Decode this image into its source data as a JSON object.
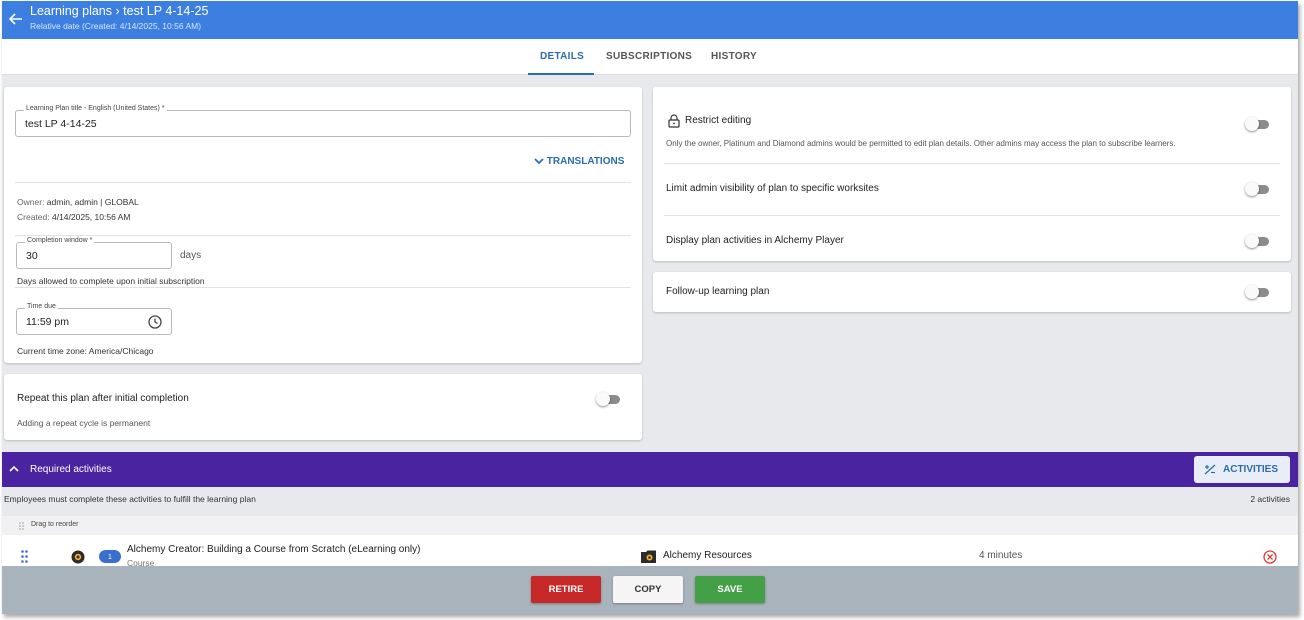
{
  "header": {
    "breadcrumb_root": "Learning plans",
    "breadcrumb_sep": "›",
    "plan_name": "test LP 4-14-25",
    "subtitle": "Relative date (Created: 4/14/2025, 10:56 AM)"
  },
  "tabs": [
    {
      "label": "DETAILS",
      "active": true
    },
    {
      "label": "SUBSCRIPTIONS",
      "active": false
    },
    {
      "label": "HISTORY",
      "active": false
    }
  ],
  "details": {
    "title_label": "Learning Plan title - English (United States) *",
    "title_value": "test LP 4-14-25",
    "translations_label": "TRANSLATIONS",
    "owner_label": "Owner:",
    "owner_value": "admin, admin | GLOBAL",
    "created_label": "Created:",
    "created_value": "4/14/2025, 10:56 AM",
    "completion_label": "Completion window *",
    "completion_value": "30",
    "completion_unit": "days",
    "completion_help": "Days allowed to complete upon initial subscription",
    "time_due_label": "Time due",
    "time_due_value": "11:59 pm",
    "timezone_text": "Current time zone: America/Chicago"
  },
  "repeat": {
    "label": "Repeat this plan after initial completion",
    "help": "Adding a repeat cycle is permanent",
    "enabled": false
  },
  "settings": {
    "restrict_label": "Restrict editing",
    "restrict_help": "Only the owner, Platinum and Diamond admins would be permitted to edit plan details. Other admins may access the plan to subscribe learners.",
    "limit_label": "Limit admin visibility of plan to specific worksites",
    "display_label": "Display plan activities in Alchemy Player",
    "followup_label": "Follow-up learning plan"
  },
  "required": {
    "title": "Required activities",
    "button_label": "ACTIVITIES",
    "description": "Employees must complete these activities to fulfill the learning plan",
    "count_text": "2 activities",
    "drag_text": "Drag to reorder",
    "rows": [
      {
        "order": "1",
        "name": "Alchemy Creator: Building a Course from Scratch (eLearning only)",
        "type": "Course",
        "source": "Alchemy Resources",
        "duration": "4 minutes"
      }
    ]
  },
  "footer": {
    "retire": "RETIRE",
    "copy": "COPY",
    "save": "SAVE"
  },
  "colors": {
    "header": "#3d7fe0",
    "required_bar": "#4a24a0",
    "retire": "#c62828",
    "save": "#43a047",
    "link": "#2b6cb0"
  }
}
